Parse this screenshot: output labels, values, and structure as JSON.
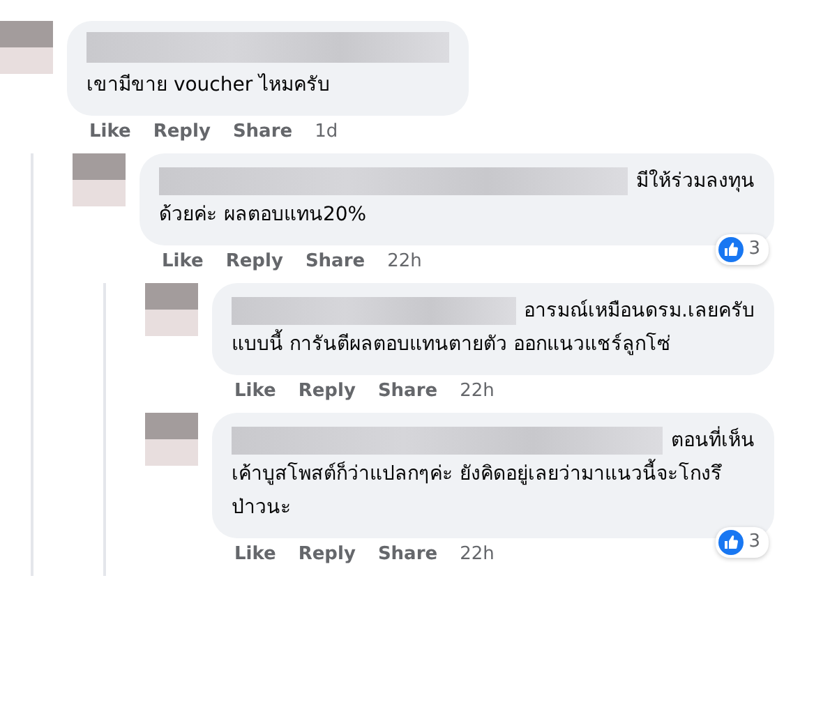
{
  "comments": [
    {
      "text": "เขามีขาย voucher ไหมครับ",
      "actions": [
        "Like",
        "Reply",
        "Share"
      ],
      "time": "1d",
      "children": [
        {
          "lead": "มีให้ร่วมลงทุน",
          "text": "ด้วยค่ะ ผลตอบแทน20%",
          "reactions": "3",
          "actions": [
            "Like",
            "Reply",
            "Share"
          ],
          "time": "22h",
          "children": [
            {
              "lead": "อารมณ์เหมือนดรม.เลยครับ",
              "text": "แบบนี้ การันตีผลตอบแทนตายตัว ออกแนวแชร์ลูกโซ่",
              "actions": [
                "Like",
                "Reply",
                "Share"
              ],
              "time": "22h"
            },
            {
              "lead": "ตอนที่เห็น",
              "text": "เค้าบูสโพสต์ก็ว่าแปลกๆค่ะ ยังคิดอยู่เลยว่ามาแนวนี้จะโกงรึป่าวนะ",
              "reactions": "3",
              "actions": [
                "Like",
                "Reply",
                "Share"
              ],
              "time": "22h"
            }
          ]
        }
      ]
    }
  ]
}
